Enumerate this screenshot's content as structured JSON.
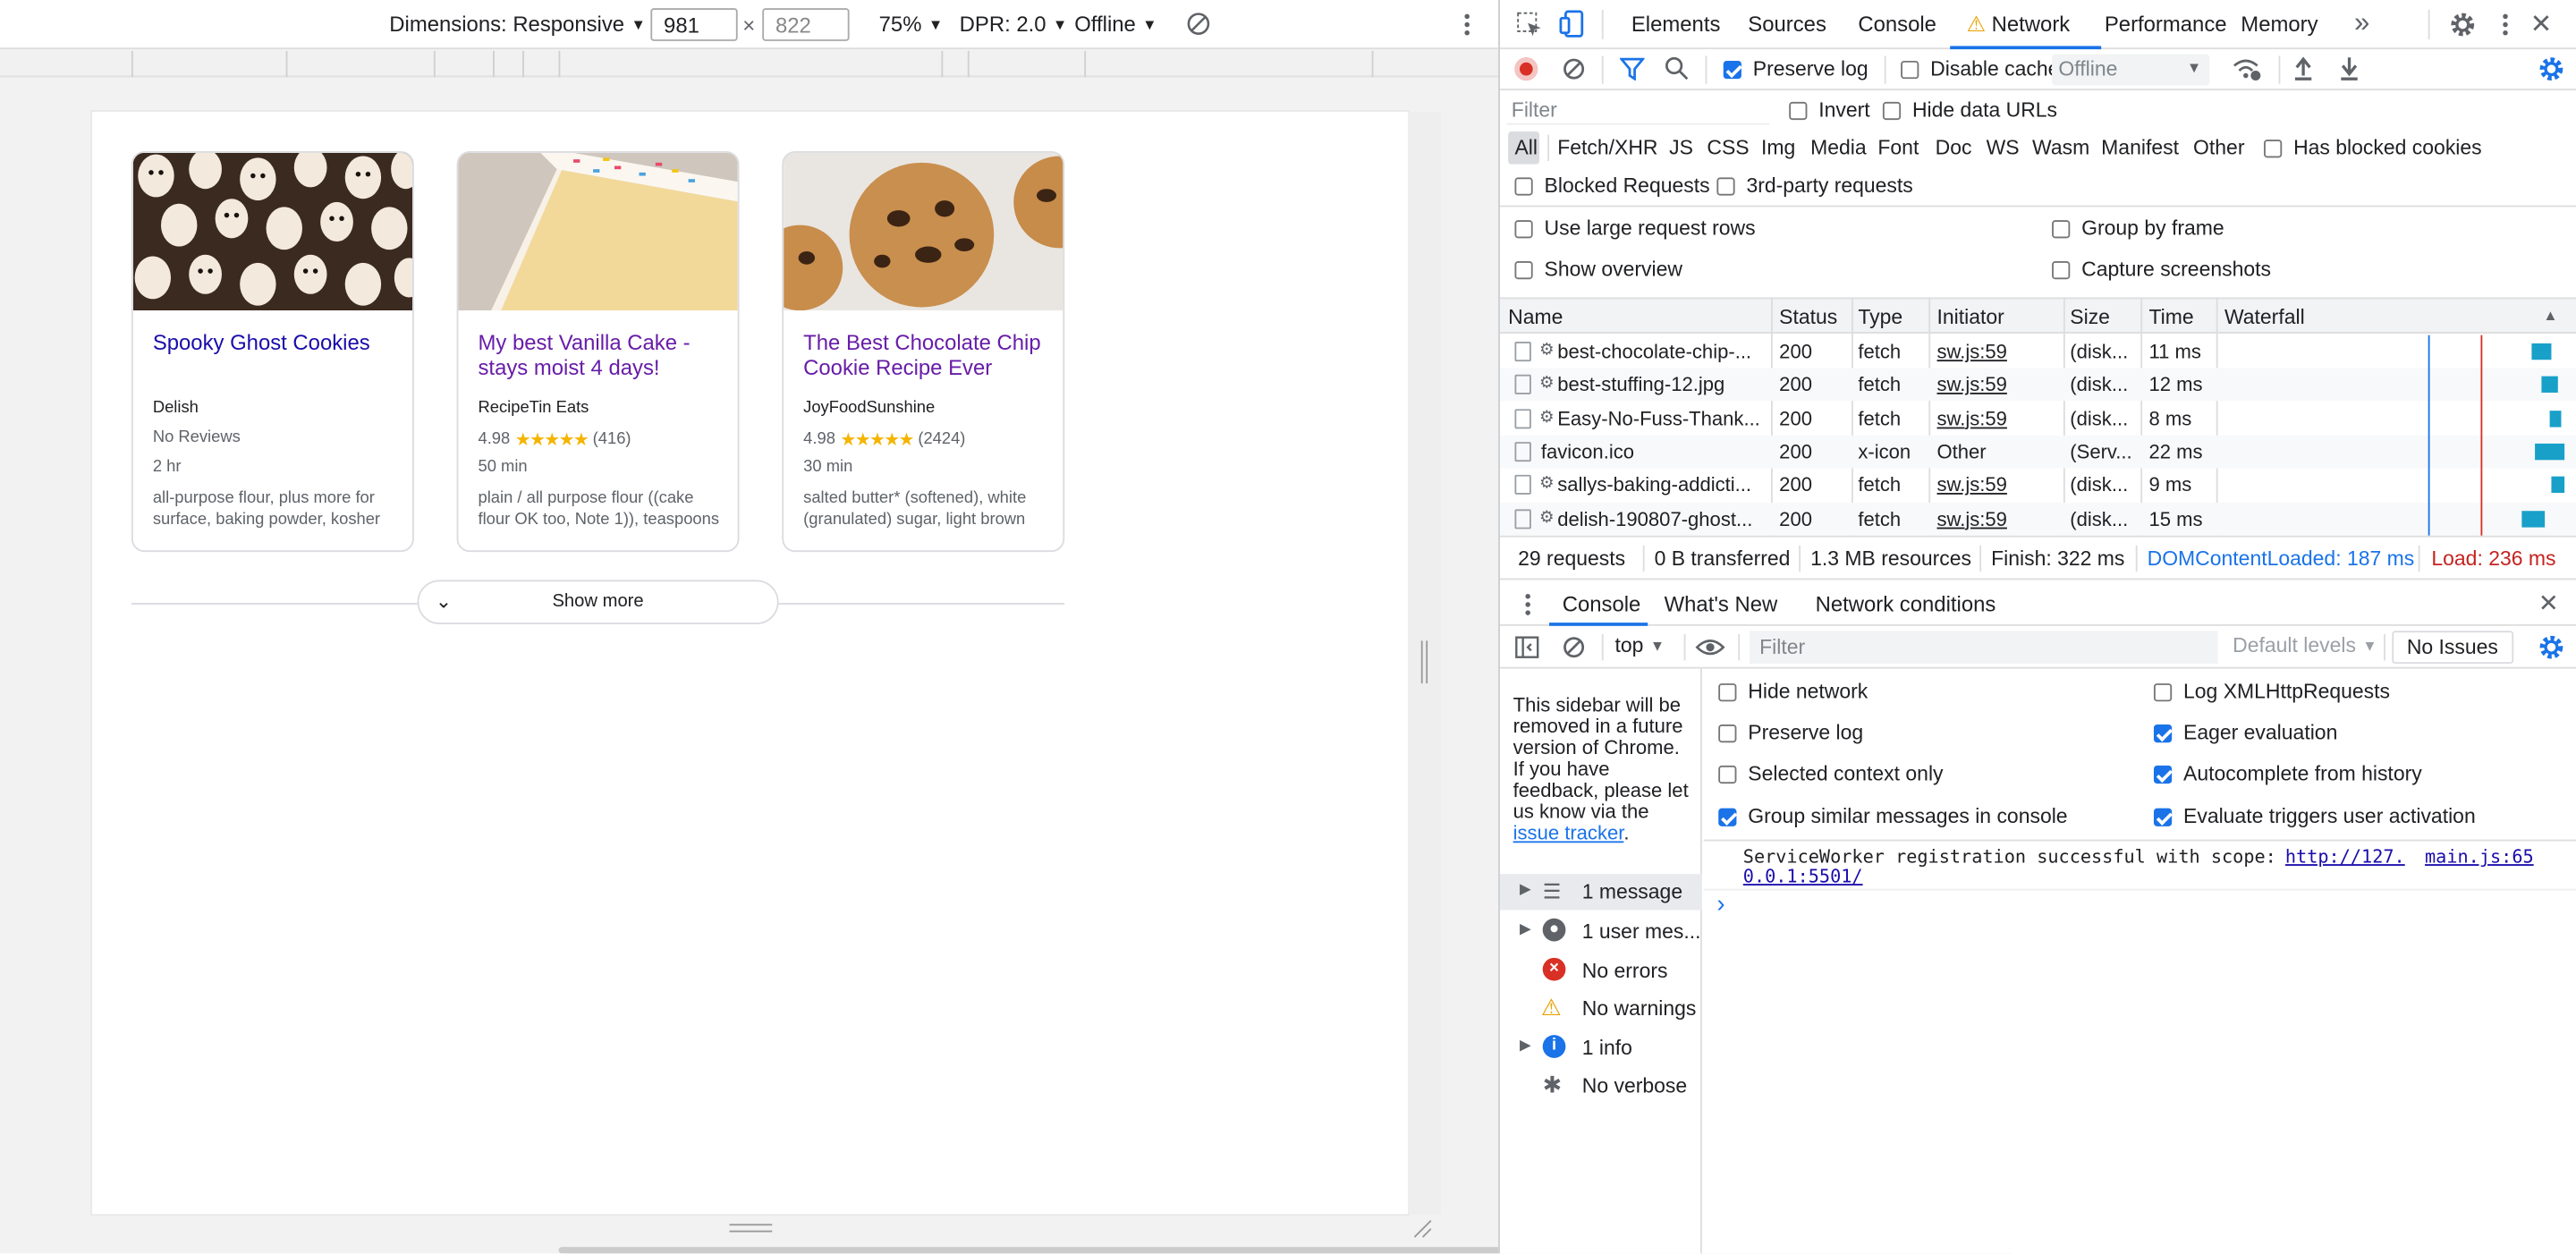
{
  "device_toolbar": {
    "dimensions_label": "Dimensions: Responsive",
    "width": "981",
    "height": "822",
    "times": "×",
    "zoom": "75%",
    "dpr": "DPR: 2.0",
    "throttle": "Offline"
  },
  "cards": [
    {
      "title": "Spooky Ghost Cookies",
      "source": "Delish",
      "rating": "",
      "stars": "",
      "reviews": "No Reviews",
      "time": "2 hr",
      "ingredients": "all-purpose flour, plus more for surface, baking powder, kosher"
    },
    {
      "title": "My best Vanilla Cake - stays moist 4 days!",
      "source": "RecipeTin Eats",
      "rating": "4.98",
      "stars": "★★★★★",
      "reviews": "(416)",
      "time": "50 min",
      "ingredients": "plain / all purpose flour ((cake flour OK too, Note 1)), teaspoons"
    },
    {
      "title": "The Best Chocolate Chip Cookie Recipe Ever",
      "source": "JoyFoodSunshine",
      "rating": "4.98",
      "stars": "★★★★★",
      "reviews": "(2424)",
      "time": "30 min",
      "ingredients": "salted butter* (softened), white (granulated) sugar, light brown"
    }
  ],
  "show_more": "Show more",
  "devtools": {
    "tabs": [
      "Elements",
      "Sources",
      "Console",
      "Network",
      "Performance",
      "Memory"
    ],
    "more_tabs": "»",
    "network_toolbar": {
      "preserve_log": "Preserve log",
      "disable_cache": "Disable cache",
      "throttle": "Offline"
    },
    "filter": {
      "placeholder": "Filter",
      "invert": "Invert",
      "hide_data_urls": "Hide data URLs",
      "types": [
        "All",
        "Fetch/XHR",
        "JS",
        "CSS",
        "Img",
        "Media",
        "Font",
        "Doc",
        "WS",
        "Wasm",
        "Manifest",
        "Other"
      ],
      "has_blocked_cookies": "Has blocked cookies",
      "blocked_requests": "Blocked Requests",
      "third_party": "3rd-party requests"
    },
    "settings": {
      "large_rows": "Use large request rows",
      "group_by_frame": "Group by frame",
      "show_overview": "Show overview",
      "capture_screenshots": "Capture screenshots"
    },
    "columns": [
      "Name",
      "Status",
      "Type",
      "Initiator",
      "Size",
      "Time",
      "Waterfall"
    ],
    "requests": [
      {
        "name": "best-chocolate-chip-...",
        "status": "200",
        "type": "fetch",
        "initiator": "sw.js:59",
        "size": "(disk...",
        "time": "11 ms",
        "sw": "⚙"
      },
      {
        "name": "best-stuffing-12.jpg",
        "status": "200",
        "type": "fetch",
        "initiator": "sw.js:59",
        "size": "(disk...",
        "time": "12 ms",
        "sw": "⚙"
      },
      {
        "name": "Easy-No-Fuss-Thank...",
        "status": "200",
        "type": "fetch",
        "initiator": "sw.js:59",
        "size": "(disk...",
        "time": "8 ms",
        "sw": "⚙"
      },
      {
        "name": "favicon.ico",
        "status": "200",
        "type": "x-icon",
        "initiator": "Other",
        "size": "(Serv...",
        "time": "22 ms",
        "sw": ""
      },
      {
        "name": "sallys-baking-addicti...",
        "status": "200",
        "type": "fetch",
        "initiator": "sw.js:59",
        "size": "(disk...",
        "time": "9 ms",
        "sw": "⚙"
      },
      {
        "name": "delish-190807-ghost...",
        "status": "200",
        "type": "fetch",
        "initiator": "sw.js:59",
        "size": "(disk...",
        "time": "15 ms",
        "sw": "⚙"
      }
    ],
    "summary": {
      "requests": "29 requests",
      "transferred": "0 B transferred",
      "resources": "1.3 MB resources",
      "finish": "Finish: 322 ms",
      "dcl": "DOMContentLoaded: 187 ms",
      "load": "Load: 236 ms"
    },
    "drawer_tabs": [
      "Console",
      "What's New",
      "Network conditions"
    ],
    "console_toolbar": {
      "context": "top",
      "filter_placeholder": "Filter",
      "levels": "Default levels",
      "issues": "No Issues"
    },
    "sidebar_notice": "This sidebar will be removed in a future version of Chrome. If you have feedback, please let us know via the",
    "sidebar_link": "issue tracker",
    "sidebar_period": ".",
    "console_settings_left": [
      "Hide network",
      "Preserve log",
      "Selected context only",
      "Group similar messages in console"
    ],
    "console_settings_right": [
      "Log XMLHttpRequests",
      "Eager evaluation",
      "Autocomplete from history",
      "Evaluate triggers user activation"
    ],
    "sidebar_items": [
      "1 message",
      "1 user mes...",
      "No errors",
      "No warnings",
      "1 info",
      "No verbose"
    ],
    "console_message": "ServiceWorker registration successful with scope:",
    "console_url_1": "http://127.",
    "console_url_2": "0.0.1:5501/",
    "console_source": "main.js:65",
    "prompt": "›"
  }
}
